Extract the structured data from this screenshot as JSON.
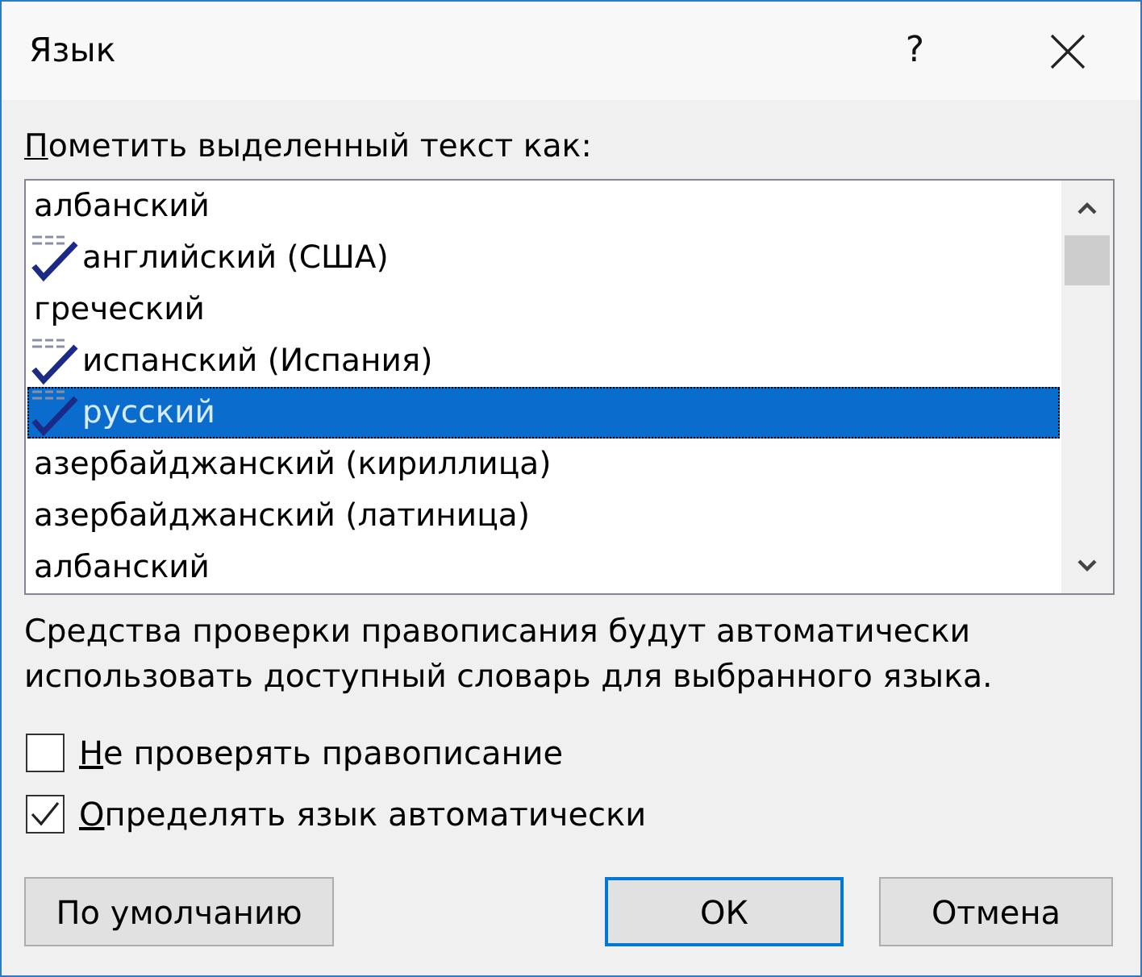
{
  "window": {
    "title": "Язык",
    "help_button": "?"
  },
  "language_list": {
    "label": "Пометить выделенный текст как:",
    "items": [
      {
        "name": "албанский",
        "spellcheck": false,
        "selected": false
      },
      {
        "name": "английский (США)",
        "spellcheck": true,
        "selected": false
      },
      {
        "name": "греческий",
        "spellcheck": false,
        "selected": false
      },
      {
        "name": "испанский (Испания)",
        "spellcheck": true,
        "selected": false
      },
      {
        "name": "русский",
        "spellcheck": true,
        "selected": true
      },
      {
        "name": "азербайджанский (кириллица)",
        "spellcheck": false,
        "selected": false
      },
      {
        "name": "азербайджанский (латиница)",
        "spellcheck": false,
        "selected": false
      },
      {
        "name": "албанский",
        "spellcheck": false,
        "selected": false
      }
    ]
  },
  "note": "Средства проверки правописания будут автоматически использовать доступный словарь для выбранного языка.",
  "checkboxes": [
    {
      "label": "Не проверять правописание",
      "checked": false
    },
    {
      "label": "Определять язык автоматически",
      "checked": true
    }
  ],
  "buttons": [
    {
      "label": "По умолчанию",
      "default": false
    },
    {
      "label": "ОК",
      "default": true
    },
    {
      "label": "Отмена",
      "default": false
    }
  ]
}
